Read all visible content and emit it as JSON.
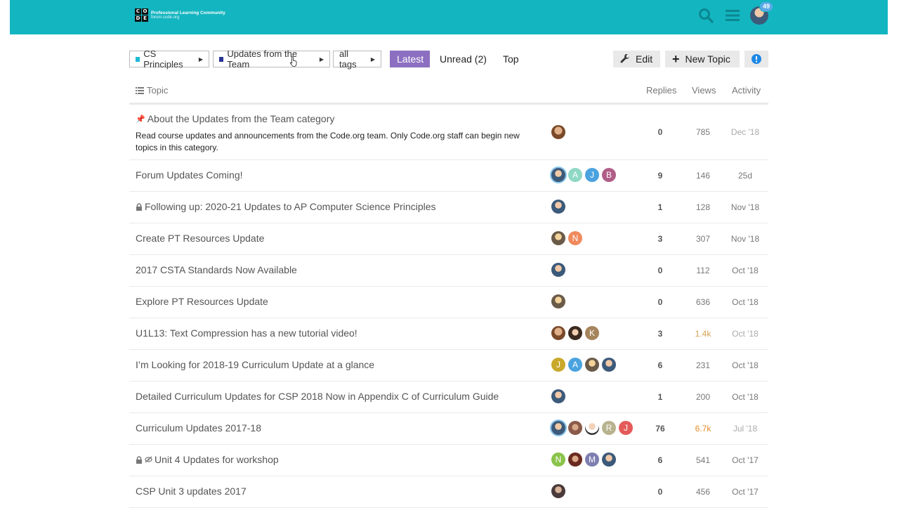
{
  "header": {
    "logo_cells": [
      "C",
      "O",
      "D",
      "E"
    ],
    "logo_title": "Professional Learning Community",
    "logo_subtitle": "forum.code.org",
    "notification_count": "49",
    "icons": [
      "search-icon",
      "hamburger-icon",
      "user-avatar"
    ],
    "bar_color": "#13b5c0"
  },
  "nav": {
    "category": "CS Principles",
    "category_color": "#1eb8d6",
    "subcategory": "Updates from the Team",
    "subcategory_color": "#283593",
    "tags": "all tags",
    "tabs": [
      "Latest",
      "Unread (2)",
      "Top"
    ],
    "active_tab_color": "#8c6fc1",
    "edit": "Edit",
    "new_topic": "New Topic"
  },
  "table": {
    "headers": {
      "topic": "Topic",
      "replies": "Replies",
      "views": "Views",
      "activity": "Activity"
    },
    "rows": [
      {
        "title": "About the Updates from the Team category",
        "excerpt": "Read course updates and announcements from the Code.org team. Only Code.org staff can begin new topics in this category.",
        "replies": "0",
        "views": "785",
        "activity": "Dec '18"
      },
      {
        "title": "Forum Updates Coming!",
        "replies": "9",
        "views": "146",
        "activity": "25d",
        "letters": [
          "A",
          "J",
          "B"
        ]
      },
      {
        "title": "Following up: 2020-21 Updates to AP Computer Science Principles",
        "replies": "1",
        "views": "128",
        "activity": "Nov '18"
      },
      {
        "title": "Create PT Resources Update",
        "replies": "3",
        "views": "307",
        "activity": "Nov '18",
        "letters": [
          "N"
        ]
      },
      {
        "title": "2017 CSTA Standards Now Available",
        "replies": "0",
        "views": "112",
        "activity": "Oct '18"
      },
      {
        "title": "Explore PT Resources Update",
        "replies": "0",
        "views": "636",
        "activity": "Oct '18"
      },
      {
        "title": "U1L13: Text Compression has a new tutorial video!",
        "replies": "3",
        "views": "1.4k",
        "activity": "Oct '18",
        "letters": [
          "K"
        ]
      },
      {
        "title": "I’m Looking for 2018-19 Curriculum Update at a glance",
        "replies": "6",
        "views": "231",
        "activity": "Oct '18",
        "letters": [
          "J",
          "A"
        ]
      },
      {
        "title": "Detailed Curriculum Updates for CSP 2018 Now in Appendix C of Curriculum Guide",
        "replies": "1",
        "views": "200",
        "activity": "Oct '18"
      },
      {
        "title": "Curriculum Updates 2017-18",
        "replies": "76",
        "views": "6.7k",
        "activity": "Jul '18",
        "letters": [
          "R",
          "J"
        ]
      },
      {
        "title": "Unit 4 Updates for workshop",
        "replies": "6",
        "views": "541",
        "activity": "Oct '17",
        "letters": [
          "N",
          "M"
        ]
      },
      {
        "title": "CSP Unit 3 updates 2017",
        "replies": "0",
        "views": "456",
        "activity": "Oct '17"
      }
    ]
  }
}
